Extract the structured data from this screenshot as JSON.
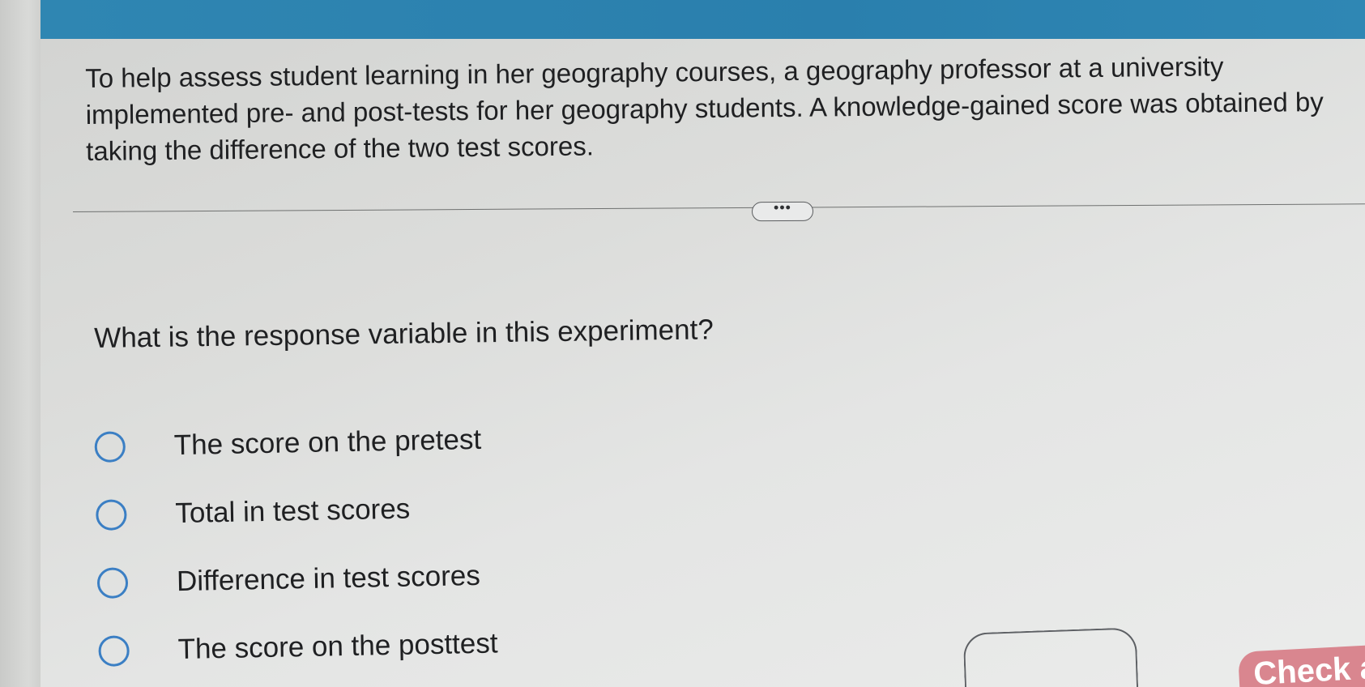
{
  "header": {
    "accent_color": "#2f86b2"
  },
  "problem": {
    "intro": "To help assess student learning in her geography courses, a geography professor at a university implemented pre- and post-tests for her geography students. A knowledge-gained score was obtained by taking the difference of the two test scores.",
    "more_label": "•••",
    "question": "What is the response variable in this experiment?",
    "options": [
      {
        "label": "The score on the pretest"
      },
      {
        "label": "Total in test scores"
      },
      {
        "label": "Difference in test scores"
      },
      {
        "label": "The score on the posttest"
      }
    ]
  },
  "footer": {
    "check_label": "Check a",
    "check_color": "#d9868f"
  }
}
